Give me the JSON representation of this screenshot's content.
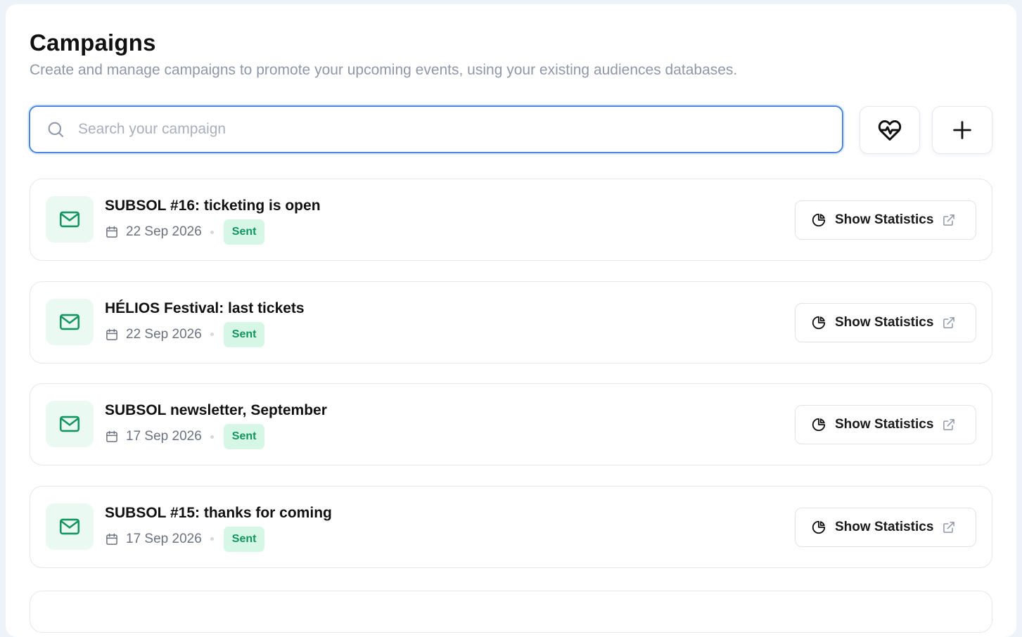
{
  "header": {
    "title": "Campaigns",
    "subtitle": "Create and manage campaigns to promote your upcoming events, using your existing audiences databases."
  },
  "search": {
    "placeholder": "Search your campaign",
    "value": "",
    "icon": "search-icon"
  },
  "toolbar": {
    "health_icon": "heart-pulse-icon",
    "add_icon": "plus-icon"
  },
  "colors": {
    "accent_focus": "#4a86e0",
    "status_sent_bg": "#d6f7e6",
    "status_sent_text": "#13955f",
    "mail_icon": "#13955f"
  },
  "campaigns": [
    {
      "title": "SUBSOL #16: ticketing is open",
      "date": "22 Sep 2026",
      "status": "Sent",
      "action_label": "Show Statistics"
    },
    {
      "title": "HÉLIOS Festival: last tickets",
      "date": "22 Sep 2026",
      "status": "Sent",
      "action_label": "Show Statistics"
    },
    {
      "title": "SUBSOL newsletter, September",
      "date": "17 Sep 2026",
      "status": "Sent",
      "action_label": "Show Statistics"
    },
    {
      "title": "SUBSOL #15: thanks for coming",
      "date": "17 Sep 2026",
      "status": "Sent",
      "action_label": "Show Statistics"
    }
  ]
}
